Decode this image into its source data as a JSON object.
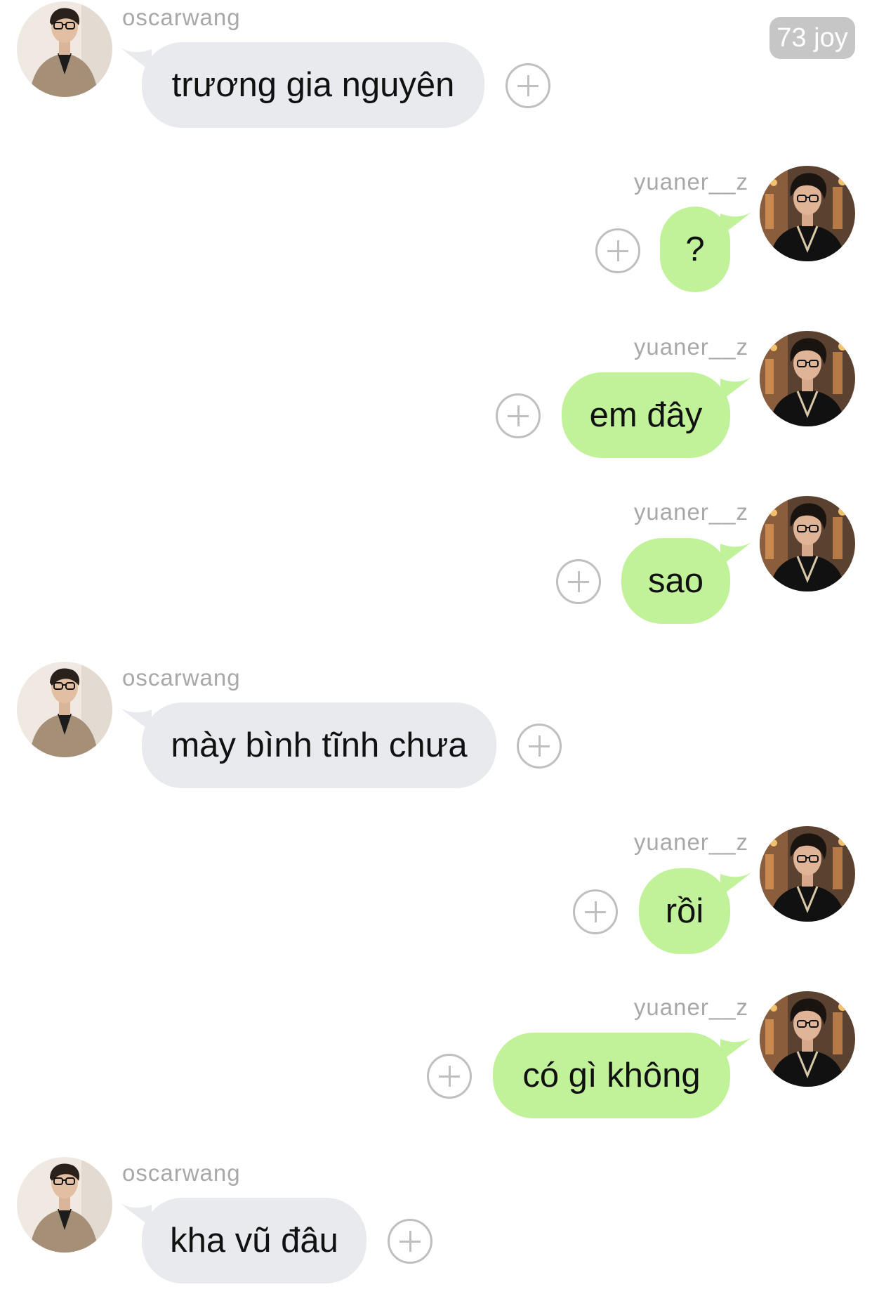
{
  "badge": {
    "text": "73 joy"
  },
  "users": {
    "left": {
      "name": "oscarwang"
    },
    "right": {
      "name": "yuaner__z"
    }
  },
  "messages": [
    {
      "sender": "oscarwang",
      "text": "trương gia nguyên"
    },
    {
      "sender": "yuaner__z",
      "text": "?"
    },
    {
      "sender": "yuaner__z",
      "text": "em đây"
    },
    {
      "sender": "yuaner__z",
      "text": "sao"
    },
    {
      "sender": "oscarwang",
      "text": "mày bình tĩnh chưa"
    },
    {
      "sender": "yuaner__z",
      "text": "rồi"
    },
    {
      "sender": "yuaner__z",
      "text": "có gì không"
    },
    {
      "sender": "oscarwang",
      "text": "kha vũ đâu"
    }
  ],
  "colors": {
    "incoming_bubble": "#e8eaed",
    "outgoing_bubble": "#c1f29a",
    "username": "#a8a8a8",
    "badge_bg": "#c6c6c6",
    "plus_icon": "#bfbfbf"
  },
  "icons": {
    "react": "plus-circle-icon",
    "avatar": "avatar"
  }
}
